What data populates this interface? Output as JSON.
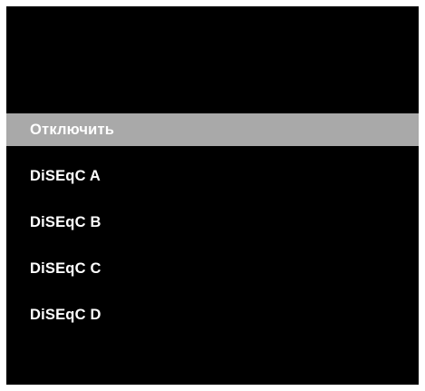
{
  "menu": {
    "items": [
      {
        "label": "Отключить",
        "selected": true
      },
      {
        "label": "DiSEqC A",
        "selected": false
      },
      {
        "label": "DiSEqC B",
        "selected": false
      },
      {
        "label": "DiSEqC C",
        "selected": false
      },
      {
        "label": "DiSEqC D",
        "selected": false
      }
    ]
  },
  "colors": {
    "background": "#000000",
    "selected_bar": "#a9a9a9",
    "text": "#ffffff"
  }
}
